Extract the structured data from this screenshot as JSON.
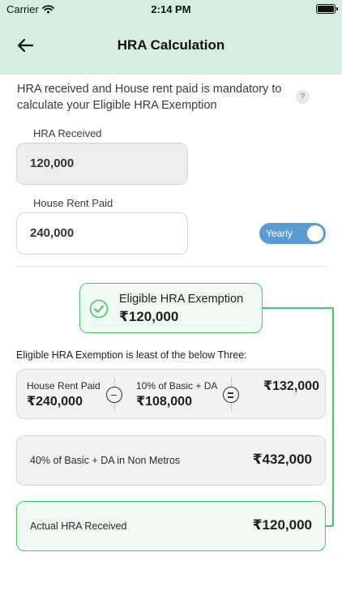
{
  "status_bar": {
    "carrier": "Carrier",
    "time": "2:14 PM"
  },
  "header": {
    "title": "HRA Calculation"
  },
  "intro": {
    "text": "HRA received and House rent paid is mandatory to calculate your Eligible HRA Exemption",
    "help": "?"
  },
  "hra_received": {
    "label": "HRA Received",
    "value": "120,000"
  },
  "rent_paid": {
    "label": "House Rent Paid",
    "value": "240,000"
  },
  "frequency_toggle": {
    "label": "Yearly",
    "on": true
  },
  "exemption": {
    "title": "Eligible HRA Exemption",
    "value": "₹120,000"
  },
  "least_caption": "Eligible HRA Exemption is least of the below Three:",
  "calc_row": {
    "rent_label": "House Rent Paid",
    "rent_value": "₹240,000",
    "basic_label": "10% of Basic + DA",
    "basic_value": "₹108,000",
    "total_value": "₹132,000"
  },
  "metro_row": {
    "label": "40% of Basic + DA in Non Metros",
    "value": "₹432,000"
  },
  "actual_row": {
    "label": "Actual HRA Received",
    "value": "₹120,000"
  },
  "colors": {
    "header_bg": "#d6eee0",
    "accent_green": "#4cc36e",
    "toggle_blue": "#5b9bd5"
  }
}
